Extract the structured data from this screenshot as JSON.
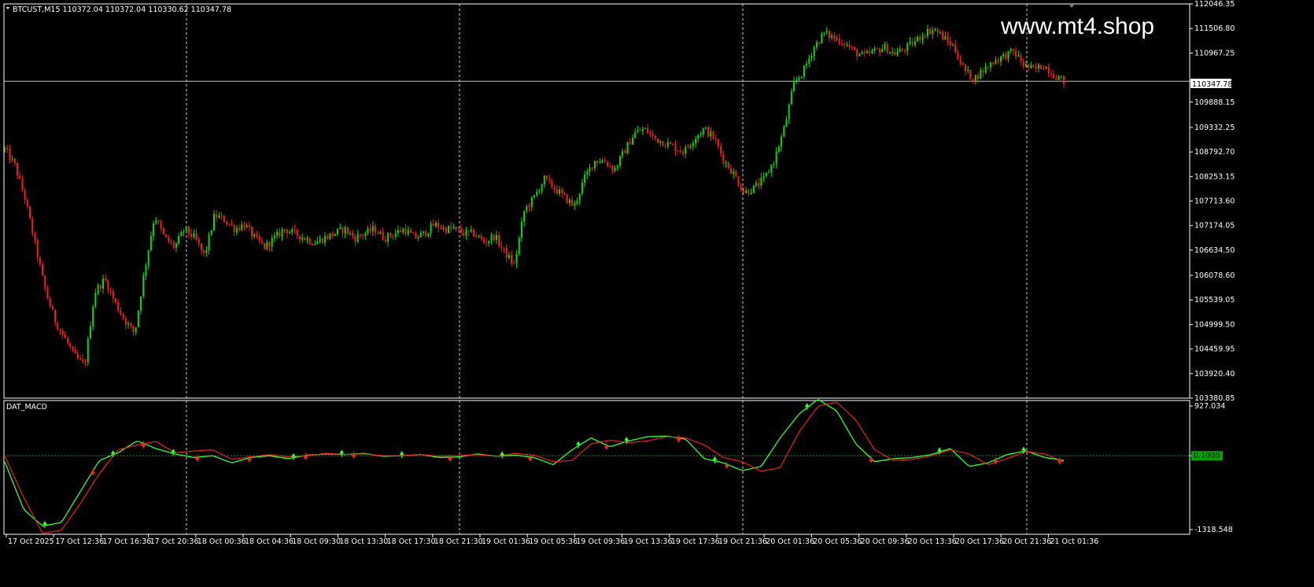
{
  "window": {
    "symbol_info": "BTCUST,M15  110372.04 110372.04 110330.62 110347.78",
    "watermark": "www.mt4.shop",
    "indicator_name": "DAT_MACD",
    "current_price_label": "110347.78"
  },
  "colors": {
    "background": "#000000",
    "border": "#ffffff",
    "bull": "#00e000",
    "bear": "#ff1a1a",
    "macd_line": "#33ff33",
    "signal_line": "#ff2020",
    "zero_line": "#00a000",
    "text": "#ffffff"
  },
  "chart_data": [
    {
      "type": "candlestick",
      "title": "BTCUST,M15  110372.04 110372.04 110330.62 110347.78",
      "ylim": [
        103380.85,
        112046.35
      ],
      "y_ticks": [
        "112046.35",
        "111506.80",
        "110967.25",
        "110347.78",
        "109888.15",
        "109332.25",
        "108792.70",
        "108253.15",
        "107713.60",
        "107174.05",
        "106634.50",
        "106078.60",
        "105539.05",
        "104999.50",
        "104459.95",
        "103920.40",
        "103380.85"
      ],
      "x_ticks": [
        "17 Oct 2025",
        "17 Oct 12:36",
        "17 Oct 16:36",
        "17 Oct 20:36",
        "18 Oct 00:36",
        "18 Oct 04:36",
        "18 Oct 09:30",
        "18 Oct 13:30",
        "18 Oct 17:30",
        "18 Oct 21:30",
        "19 Oct 01:36",
        "19 Oct 05:36",
        "19 Oct 09:36",
        "19 Oct 13:36",
        "19 Oct 17:36",
        "19 Oct 21:36",
        "20 Oct 01:36",
        "20 Oct 05:36",
        "20 Oct 09:36",
        "20 Oct 13:36",
        "20 Oct 17:36",
        "20 Oct 21:36",
        "21 Oct 01:36"
      ],
      "current_price": 110347.78,
      "close_path": [
        108850,
        108500,
        107800,
        106800,
        105800,
        105100,
        104700,
        104300,
        104100,
        105700,
        106000,
        105500,
        105100,
        104800,
        106200,
        107400,
        106900,
        106700,
        107100,
        106900,
        106500,
        107400,
        107300,
        107100,
        107200,
        106900,
        106700,
        106900,
        107100,
        107000,
        106900,
        106800,
        106900,
        107000,
        107100,
        106900,
        107000,
        107100,
        106900,
        107000,
        107100,
        106900,
        107000,
        107200,
        107100,
        107100,
        107000,
        107000,
        106800,
        106950,
        106600,
        106300,
        107500,
        107800,
        108200,
        108000,
        107800,
        107600,
        108200,
        108600,
        108600,
        108400,
        108800,
        109200,
        109300,
        109100,
        109000,
        108900,
        108800,
        109100,
        109300,
        109100,
        108600,
        108300,
        107900,
        108000,
        108200,
        108600,
        109300,
        110300,
        110600,
        111100,
        111400,
        111300,
        111200,
        111000,
        110900,
        111000,
        111100,
        110950,
        111050,
        111200,
        111400,
        111500,
        111300,
        111100,
        110600,
        110400,
        110600,
        110800,
        110900,
        111000,
        110700,
        110600,
        110700,
        110500,
        110347.78
      ]
    },
    {
      "type": "line",
      "title": "DAT_MACD",
      "ylim": [
        -1318.548,
        927.034
      ],
      "y_ticks": [
        "927.034",
        "0.1000",
        "-1318.548"
      ],
      "series": [
        {
          "name": "",
          "color": "#33ff33",
          "values": [
            -100,
            -900,
            -1180,
            -1120,
            -600,
            -80,
            50,
            250,
            120,
            30,
            -30,
            0,
            -120,
            -30,
            0,
            -50,
            10,
            30,
            20,
            40,
            -10,
            0,
            20,
            -30,
            -20,
            30,
            -10,
            10,
            -30,
            -150,
            100,
            300,
            150,
            250,
            320,
            330,
            280,
            -50,
            -120,
            -250,
            -180,
            300,
            700,
            950,
            750,
            200,
            -100,
            -50,
            -30,
            20,
            120,
            -180,
            -120,
            20,
            80,
            -30,
            -80
          ]
        },
        {
          "name": "",
          "color": "#ff2020",
          "values": [
            0,
            -700,
            -1300,
            -1250,
            -800,
            -300,
            100,
            180,
            240,
            50,
            80,
            100,
            -60,
            -20,
            20,
            -20,
            0,
            40,
            20,
            30,
            0,
            0,
            20,
            -10,
            0,
            20,
            -10,
            40,
            10,
            -100,
            -80,
            200,
            260,
            220,
            250,
            320,
            300,
            180,
            -30,
            -100,
            -260,
            -200,
            400,
            830,
            900,
            600,
            100,
            -80,
            -60,
            0,
            100,
            30,
            -150,
            -50,
            70,
            30,
            -100
          ]
        }
      ],
      "signal_markers": [
        {
          "x": 0.05,
          "dir": "up"
        },
        {
          "x": 0.11,
          "dir": "down"
        },
        {
          "x": 0.135,
          "dir": "up"
        },
        {
          "x": 0.173,
          "dir": "down"
        },
        {
          "x": 0.21,
          "dir": "up"
        },
        {
          "x": 0.24,
          "dir": "down"
        },
        {
          "x": 0.305,
          "dir": "down"
        },
        {
          "x": 0.36,
          "dir": "up"
        },
        {
          "x": 0.375,
          "dir": "down"
        },
        {
          "x": 0.42,
          "dir": "up"
        },
        {
          "x": 0.435,
          "dir": "down"
        },
        {
          "x": 0.495,
          "dir": "up"
        },
        {
          "x": 0.555,
          "dir": "down"
        },
        {
          "x": 0.62,
          "dir": "up"
        },
        {
          "x": 0.655,
          "dir": "down"
        },
        {
          "x": 0.715,
          "dir": "up"
        },
        {
          "x": 0.75,
          "dir": "down"
        },
        {
          "x": 0.775,
          "dir": "up"
        },
        {
          "x": 0.84,
          "dir": "down"
        },
        {
          "x": 0.885,
          "dir": "up"
        },
        {
          "x": 0.9,
          "dir": "down"
        },
        {
          "x": 1.0,
          "dir": "up"
        },
        {
          "x": 1.08,
          "dir": "down"
        },
        {
          "x": 1.165,
          "dir": "up"
        },
        {
          "x": 1.235,
          "dir": "down"
        },
        {
          "x": 1.27,
          "dir": "up"
        },
        {
          "x": 1.315,
          "dir": "down"
        }
      ]
    }
  ]
}
